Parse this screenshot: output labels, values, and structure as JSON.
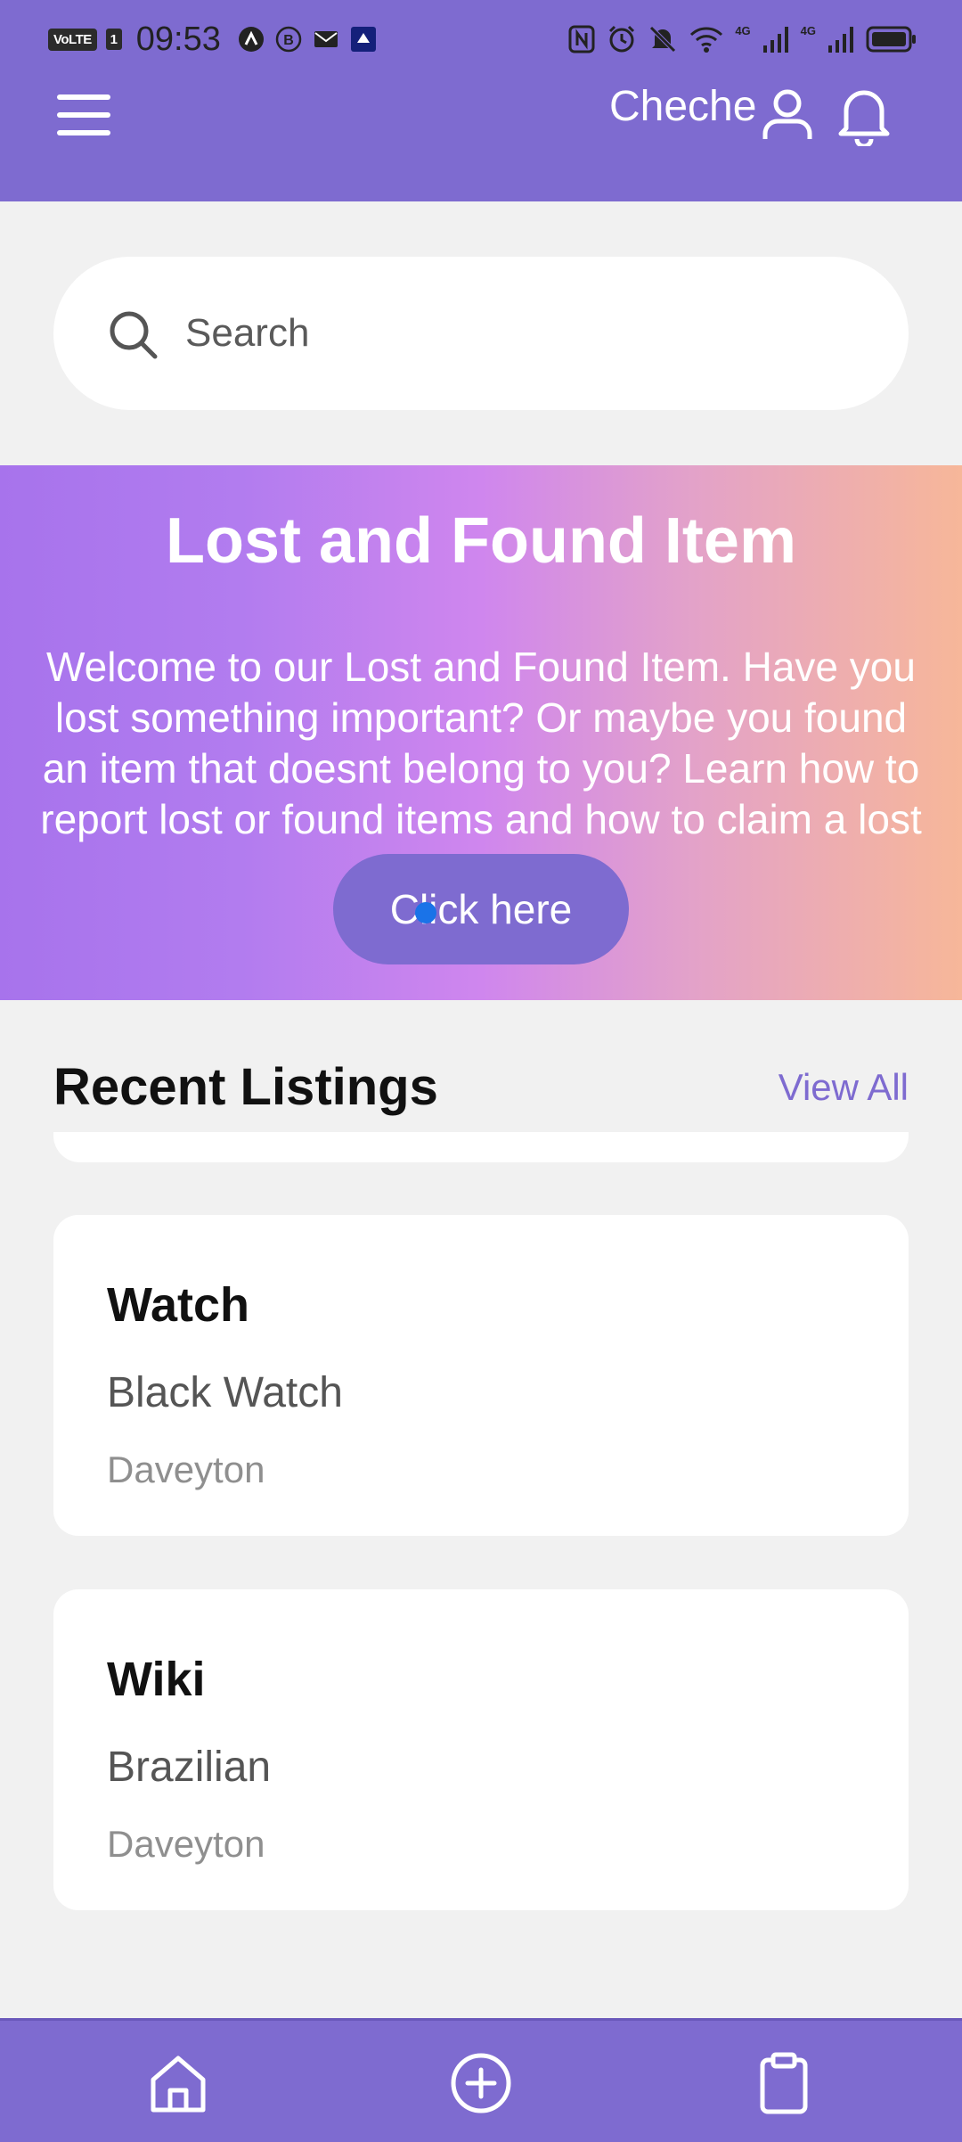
{
  "status_bar": {
    "left_badges": [
      "VoLTE",
      "1"
    ],
    "time": "09:53",
    "left_icons": [
      "app-notification-icon",
      "b-notification-icon",
      "mail-icon",
      "app-icon"
    ],
    "right_icons": [
      "nfc-icon",
      "alarm-icon",
      "mute-icon",
      "wifi-icon",
      "signal-icon",
      "signal-icon",
      "battery-icon"
    ],
    "network_label_1": "4G",
    "network_label_2": "4G"
  },
  "header": {
    "username": "Cheche",
    "background": "#7e6bd0"
  },
  "search": {
    "placeholder": "Search"
  },
  "banner": {
    "title": "Lost and Found Item",
    "lines": [
      "Welcome to our Lost and Found Item. Have you",
      "lost something important? Or maybe you found",
      "an item that doesnt belong to you? Learn how to",
      "report lost or found items and how to claim a lost"
    ],
    "button_label": "Click here"
  },
  "listings": {
    "title": "Recent Listings",
    "view_all": "View All",
    "items": [
      {
        "title": "Watch",
        "description": "Black Watch",
        "location": "Daveyton"
      },
      {
        "title": "Wiki",
        "description": "Brazilian",
        "location": "Daveyton"
      }
    ]
  },
  "bottom_nav": {
    "items": [
      "home-icon",
      "add-circle-icon",
      "clipboard-icon"
    ]
  },
  "colors": {
    "accent": "#7e6bd0",
    "page_background": "#f1f1f1"
  }
}
